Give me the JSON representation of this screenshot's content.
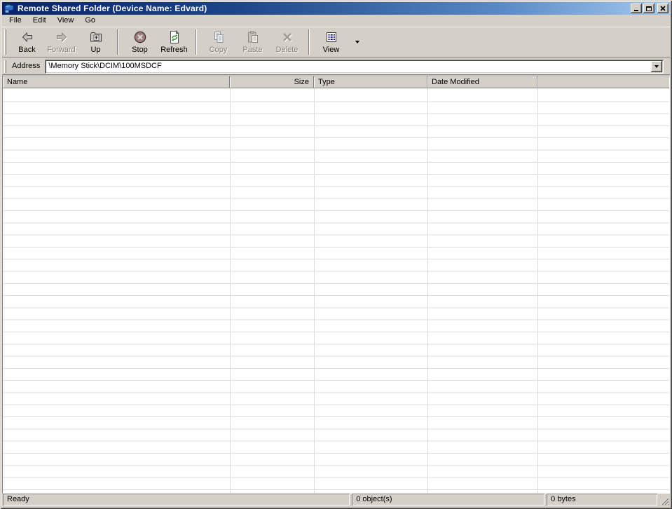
{
  "window": {
    "title": "Remote Shared Folder (Device Name: Edvard)"
  },
  "menu": {
    "items": [
      "File",
      "Edit",
      "View",
      "Go"
    ]
  },
  "toolbar": {
    "back": "Back",
    "forward": "Forward",
    "up": "Up",
    "stop": "Stop",
    "refresh": "Refresh",
    "copy": "Copy",
    "paste": "Paste",
    "delete": "Delete",
    "view": "View"
  },
  "address": {
    "label": "Address",
    "value": "\\Memory Stick\\DCIM\\100MSDCF"
  },
  "list": {
    "columns": {
      "name": "Name",
      "size": "Size",
      "type": "Type",
      "date_modified": "Date Modified"
    },
    "rows": []
  },
  "status": {
    "state": "Ready",
    "objects": "0 object(s)",
    "size": "0 bytes"
  },
  "colors": {
    "titlebar_gradient_start": "#0A246A",
    "titlebar_gradient_end": "#A6CAF0",
    "chrome": "#D4D0C8",
    "grid_line": "#DCDCDC",
    "refresh_arrow_green": "#2E8B2E",
    "stop_circle_red": "#9B7F7F",
    "view_icon_navy": "#000080"
  }
}
